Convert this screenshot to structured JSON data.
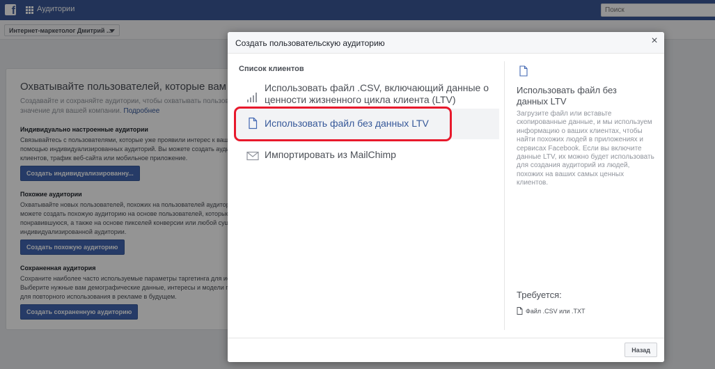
{
  "topbar": {
    "logo_glyph": "f",
    "app_title": "Аудитории",
    "search_placeholder": "Поиск"
  },
  "account": {
    "name": "Интернет-маркетолог Дмитрий ..."
  },
  "background": {
    "headline": "Охватывайте пользователей, которые вам важн",
    "intro_line1": "Создавайте и сохраняйте аудитории, чтобы охватывать пользовател",
    "intro_line2": "значение для вашей компании.",
    "intro_link": "Подробнее",
    "sections": [
      {
        "title": "Индивидуально настроенные аудитории",
        "lines": [
          "Связывайтесь с пользователями, которые уже проявили интерес к вашей компа",
          "помощью индивидуализированных аудиторий. Вы можете создать аудиторию, и",
          "клиентов, трафик веб-сайта или мобильное приложение."
        ],
        "button": "Создать индивидуализированну..."
      },
      {
        "title": "Похожие аудитории",
        "lines": [
          "Охватывайте новых пользователей, похожих на пользователей аудиторий, кото",
          "можете создать похожую аудиторию на основе пользователей, которые отметил",
          "понравившуюся, а также на основе пикселей конверсии или любой существую",
          "индивидуализированной аудитории."
        ],
        "button": "Создать похожую аудиторию"
      },
      {
        "title": "Сохраненная аудитория",
        "lines": [
          "Сохраните наиболее часто используемые параметры таргетинга для использов",
          "Выберите нужные вам демографические данные, интересы и модели поведени",
          "для повторного использования в рекламе в будущем."
        ],
        "button": "Создать сохраненную аудиторию"
      }
    ]
  },
  "modal": {
    "title": "Создать пользовательскую аудиторию",
    "close_glyph": "×",
    "section_label": "Список клиентов",
    "options": [
      {
        "label": "Использовать файл .CSV, включающий данные о ценности жизненного цикла клиента (LTV)",
        "icon": "bar-chart-icon"
      },
      {
        "label": "Использовать файл без данных LTV",
        "icon": "file-icon",
        "selected": true
      },
      {
        "label": "Импортировать из MailChimp",
        "icon": "envelope-icon"
      }
    ],
    "detail": {
      "icon": "file-icon",
      "title": "Использовать файл без данных LTV",
      "description": "Загрузите файл или вставьте скопированные данные, и мы используем информацию о ваших клиентах, чтобы найти похожих людей в приложениях и сервисах Facebook. Если вы включите данные LTV, их можно будет использовать для создания аудиторий из людей, похожих на ваших самых ценных клиентов.",
      "requirements_title": "Требуется:",
      "requirement_item": "Файл .CSV или .TXT"
    },
    "footer": {
      "back_label": "Назад"
    }
  },
  "colors": {
    "brand": "#3b5998",
    "link": "#365899",
    "button": "#4267b2",
    "highlight": "#e8192c",
    "overlay": "rgba(0,0,0,0.42)"
  }
}
